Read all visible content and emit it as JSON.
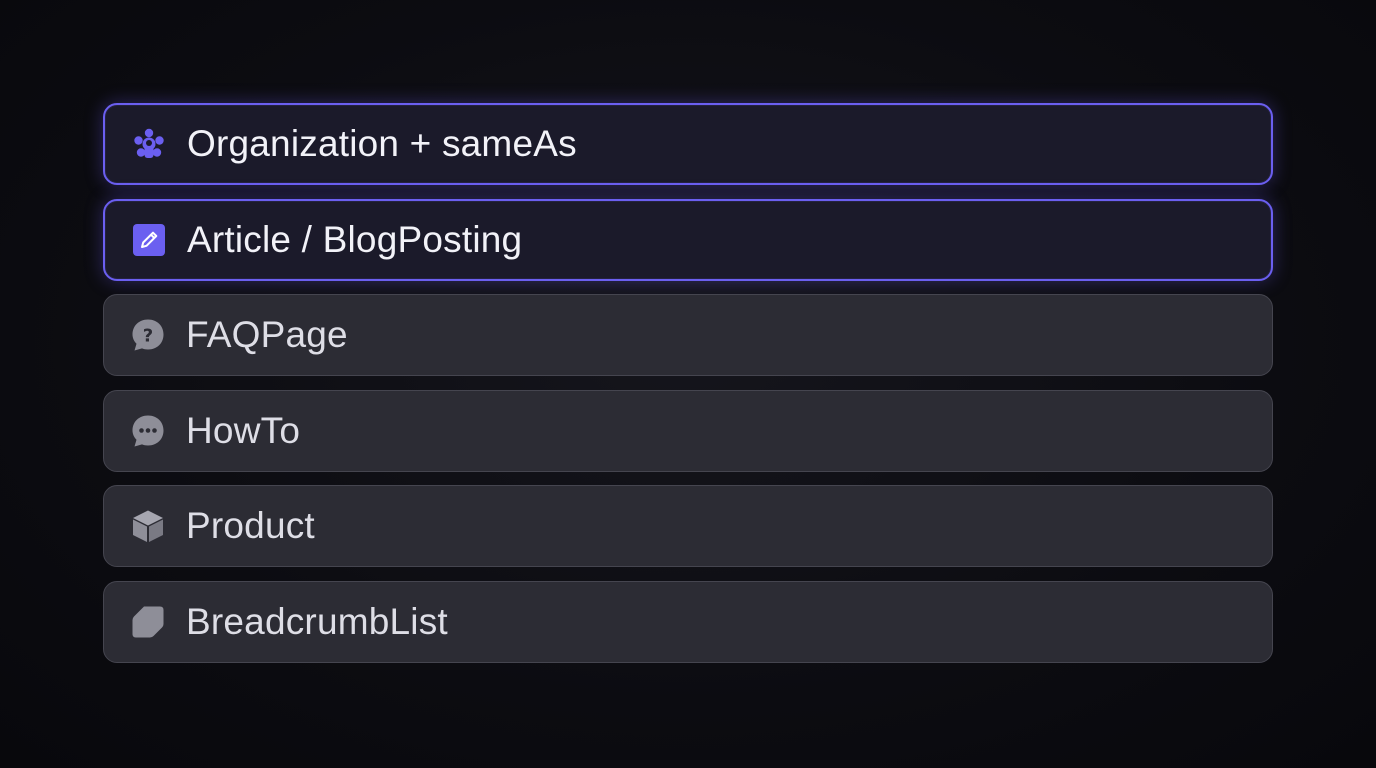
{
  "schema_list": {
    "accent_color": "#6b5ff0",
    "muted_icon_color": "#8e8e98",
    "items": [
      {
        "label": "Organization + sameAs",
        "icon": "organization-icon",
        "selected": true
      },
      {
        "label": "Article / BlogPosting",
        "icon": "edit-icon",
        "selected": true
      },
      {
        "label": "FAQPage",
        "icon": "question-bubble-icon",
        "selected": false
      },
      {
        "label": "HowTo",
        "icon": "chat-bubble-icon",
        "selected": false
      },
      {
        "label": "Product",
        "icon": "box-icon",
        "selected": false
      },
      {
        "label": "BreadcrumbList",
        "icon": "tag-icon",
        "selected": false
      }
    ]
  }
}
